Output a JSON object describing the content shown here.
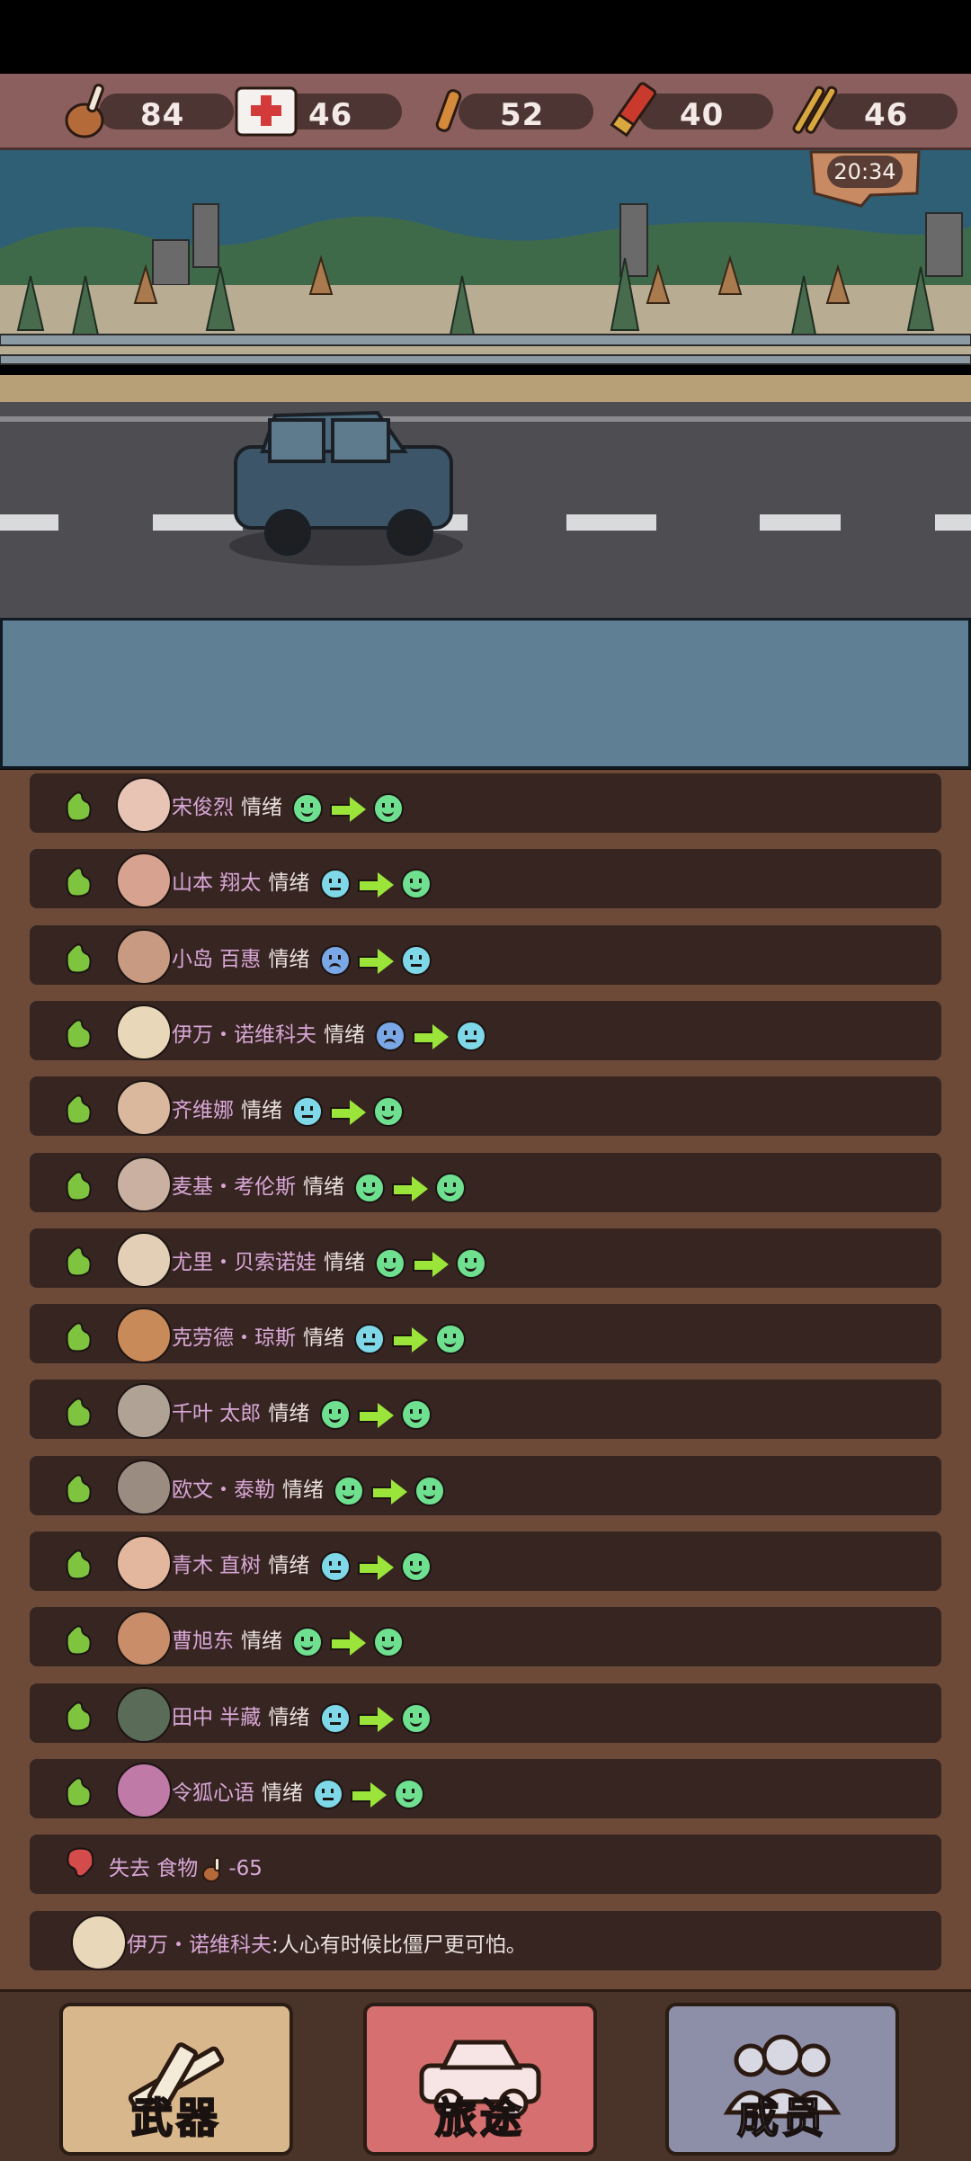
{
  "resources": [
    {
      "icon": "drumstick-food-icon",
      "value": "84"
    },
    {
      "icon": "medkit-icon",
      "value": "46"
    },
    {
      "icon": "pistol-ammo-icon",
      "value": "52"
    },
    {
      "icon": "shotgun-shell-icon",
      "value": "40"
    },
    {
      "icon": "rifle-ammo-icon",
      "value": "46"
    }
  ],
  "clock": "20:34",
  "log": {
    "mood_rows": [
      {
        "name": "宋俊烈",
        "word": "情绪",
        "from": "happy",
        "to": "happy"
      },
      {
        "name": "山本 翔太",
        "word": "情绪",
        "from": "neutral",
        "to": "happy"
      },
      {
        "name": "小岛 百惠",
        "word": "情绪",
        "from": "sad",
        "to": "neutral"
      },
      {
        "name": "伊万・诺维科夫",
        "word": "情绪",
        "from": "sad",
        "to": "neutral"
      },
      {
        "name": "齐维娜",
        "word": "情绪",
        "from": "neutral",
        "to": "happy"
      },
      {
        "name": "麦基・考伦斯",
        "word": "情绪",
        "from": "happy",
        "to": "happy"
      },
      {
        "name": "尤里・贝索诺娃",
        "word": "情绪",
        "from": "happy",
        "to": "happy"
      },
      {
        "name": "克劳德・琼斯",
        "word": "情绪",
        "from": "neutral",
        "to": "happy"
      },
      {
        "name": "千叶 太郎",
        "word": "情绪",
        "from": "happy",
        "to": "happy"
      },
      {
        "name": "欧文・泰勒",
        "word": "情绪",
        "from": "happy",
        "to": "happy"
      },
      {
        "name": "青木 直树",
        "word": "情绪",
        "from": "neutral",
        "to": "happy"
      },
      {
        "name": "曹旭东",
        "word": "情绪",
        "from": "happy",
        "to": "happy"
      },
      {
        "name": "田中 半藏",
        "word": "情绪",
        "from": "neutral",
        "to": "happy"
      },
      {
        "name": "令狐心语",
        "word": "情绪",
        "from": "neutral",
        "to": "happy"
      }
    ],
    "loss": {
      "label": "失去 食物",
      "amount": "-65"
    },
    "quote": {
      "speaker": "伊万・诺维科夫",
      "text": ":人心有时候比僵尸更可怕。"
    }
  },
  "nav": {
    "weapons": "武器",
    "journey": "旅途",
    "members": "成员"
  }
}
